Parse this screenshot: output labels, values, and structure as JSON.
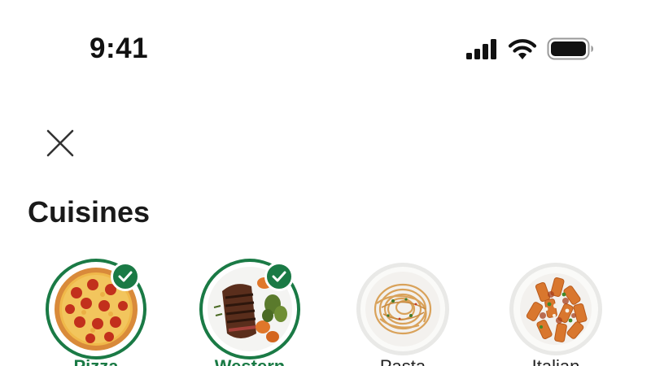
{
  "status_bar": {
    "time": "9:41",
    "icons": [
      "signal-icon",
      "wifi-icon",
      "battery-icon"
    ]
  },
  "header": {
    "close_icon": "close-icon"
  },
  "section": {
    "title": "Cuisines"
  },
  "colors": {
    "accent": "#1a7a45",
    "text": "#1a1a1a",
    "background": "#ffffff"
  },
  "cuisines": [
    {
      "label": "Pizza",
      "image": "pizza",
      "selected": true
    },
    {
      "label": "Western",
      "image": "steak",
      "selected": true
    },
    {
      "label": "Pasta",
      "image": "spaghetti",
      "selected": false
    },
    {
      "label": "Italian",
      "image": "rigatoni",
      "selected": false
    }
  ]
}
